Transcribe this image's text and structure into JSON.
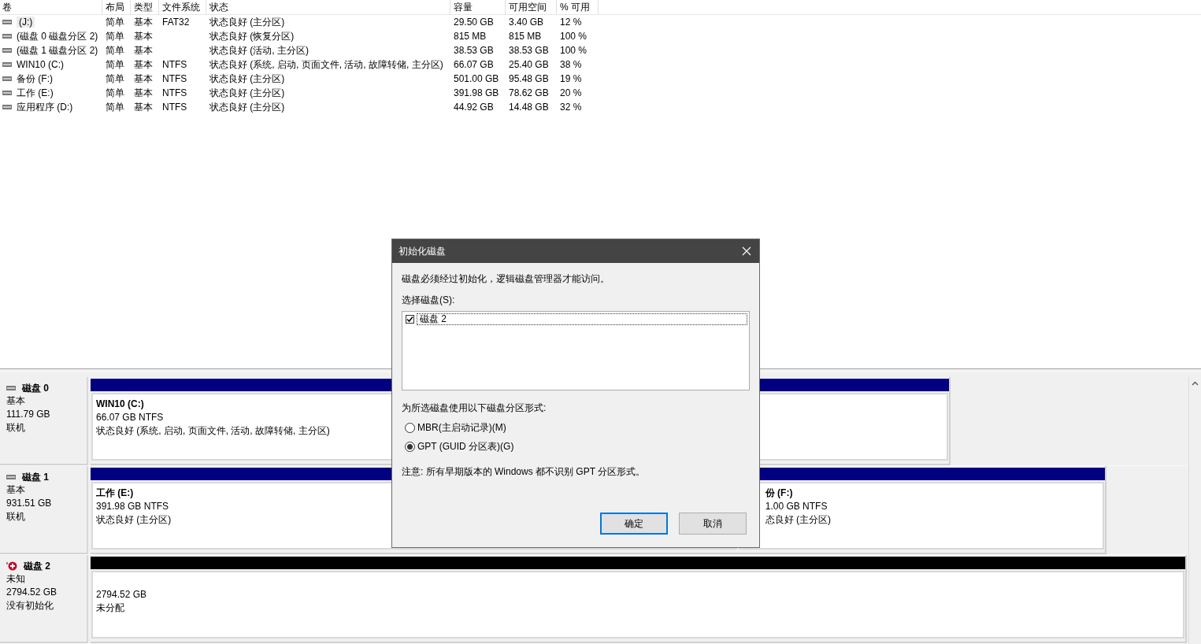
{
  "volumes": {
    "columns": [
      "卷",
      "布局",
      "类型",
      "文件系统",
      "状态",
      "容量",
      "可用空间",
      "% 可用"
    ],
    "rows": [
      {
        "selected": true,
        "cells": [
          "(J:)",
          "简单",
          "基本",
          "FAT32",
          "状态良好 (主分区)",
          "29.50 GB",
          "3.40 GB",
          "12 %"
        ]
      },
      {
        "selected": false,
        "cells": [
          "(磁盘 0 磁盘分区 2)",
          "简单",
          "基本",
          "",
          "状态良好 (恢复分区)",
          "815 MB",
          "815 MB",
          "100 %"
        ]
      },
      {
        "selected": false,
        "cells": [
          "(磁盘 1 磁盘分区 2)",
          "简单",
          "基本",
          "",
          "状态良好 (活动, 主分区)",
          "38.53 GB",
          "38.53 GB",
          "100 %"
        ]
      },
      {
        "selected": false,
        "cells": [
          "WIN10 (C:)",
          "简单",
          "基本",
          "NTFS",
          "状态良好 (系统, 启动, 页面文件, 活动, 故障转储, 主分区)",
          "66.07 GB",
          "25.40 GB",
          "38 %"
        ]
      },
      {
        "selected": false,
        "cells": [
          "备份 (F:)",
          "简单",
          "基本",
          "NTFS",
          "状态良好 (主分区)",
          "501.00 GB",
          "95.48 GB",
          "19 %"
        ]
      },
      {
        "selected": false,
        "cells": [
          "工作 (E:)",
          "简单",
          "基本",
          "NTFS",
          "状态良好 (主分区)",
          "391.98 GB",
          "78.62 GB",
          "20 %"
        ]
      },
      {
        "selected": false,
        "cells": [
          "应用程序 (D:)",
          "简单",
          "基本",
          "NTFS",
          "状态良好 (主分区)",
          "44.92 GB",
          "14.48 GB",
          "32 %"
        ]
      }
    ]
  },
  "disks": [
    {
      "kind": "online",
      "name": "磁盘 0",
      "type": "基本",
      "size": "111.79 GB",
      "status": "联机",
      "partitions": [
        {
          "kind": "primary",
          "name": "WIN10  (C:)",
          "detail": "66.07 GB NTFS",
          "status": "状态良好 (系统, 启动, 页面文件, 活动, 故障转储, 主分区)"
        }
      ]
    },
    {
      "kind": "online",
      "name": "磁盘 1",
      "type": "基本",
      "size": "931.51 GB",
      "status": "联机",
      "partitions": [
        {
          "kind": "primary",
          "name": "工作  (E:)",
          "detail": "391.98 GB NTFS",
          "status": "状态良好 (主分区)"
        },
        {
          "kind": "primary",
          "name": "份  (F:)",
          "detail": "1.00 GB NTFS",
          "status": "态良好 (主分区)"
        }
      ]
    },
    {
      "kind": "uninitialized",
      "name": "磁盘 2",
      "type": "未知",
      "size": "2794.52 GB",
      "status": "没有初始化",
      "partitions": [
        {
          "kind": "unallocated",
          "detail": "2794.52 GB",
          "status": "未分配"
        }
      ]
    }
  ],
  "dialog": {
    "title": "初始化磁盘",
    "message": "磁盘必须经过初始化，逻辑磁盘管理器才能访问。",
    "select_label": "选择磁盘(S):",
    "disk_list": [
      {
        "label": "磁盘 2",
        "checked": true
      }
    ],
    "style_label": "为所选磁盘使用以下磁盘分区形式:",
    "options": [
      {
        "label": "MBR(主启动记录)(M)",
        "selected": false
      },
      {
        "label": "GPT (GUID 分区表)(G)",
        "selected": true
      }
    ],
    "note": "注意: 所有早期版本的 Windows 都不识别 GPT 分区形式。",
    "buttons": [
      {
        "label": "确定",
        "default": true
      },
      {
        "label": "取消",
        "default": false
      }
    ]
  }
}
